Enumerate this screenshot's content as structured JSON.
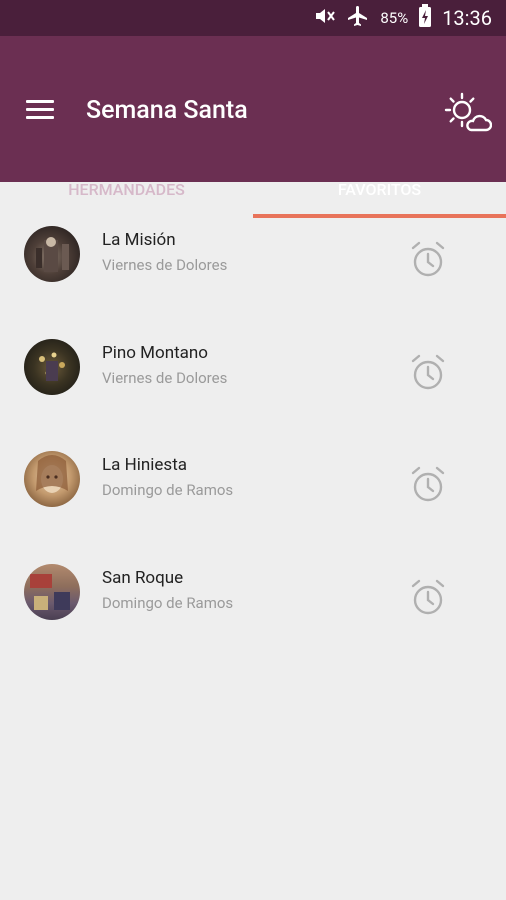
{
  "status_bar": {
    "battery": "85%",
    "time": "13:36",
    "icons": [
      "mute-icon",
      "airplane-icon",
      "battery-charging-icon"
    ]
  },
  "app_bar": {
    "title": "Semana Santa",
    "menu_icon": "hamburger-menu-icon",
    "action_icon": "weather-sun-cloud-icon"
  },
  "tabs": [
    {
      "label": "HERMANDADES",
      "active": false
    },
    {
      "label": "FAVORITOS",
      "active": true
    }
  ],
  "favorites": [
    {
      "name": "La Misión",
      "day": "Viernes de Dolores"
    },
    {
      "name": "Pino Montano",
      "day": "Viernes de Dolores"
    },
    {
      "name": "La Hiniesta",
      "day": "Domingo de Ramos"
    },
    {
      "name": "San Roque",
      "day": "Domingo de Ramos"
    }
  ],
  "colors": {
    "status_bar": "#4a1f3b",
    "app_bar": "#6b2f52",
    "tab_indicator": "#e8735a",
    "background": "#eeeeee"
  }
}
